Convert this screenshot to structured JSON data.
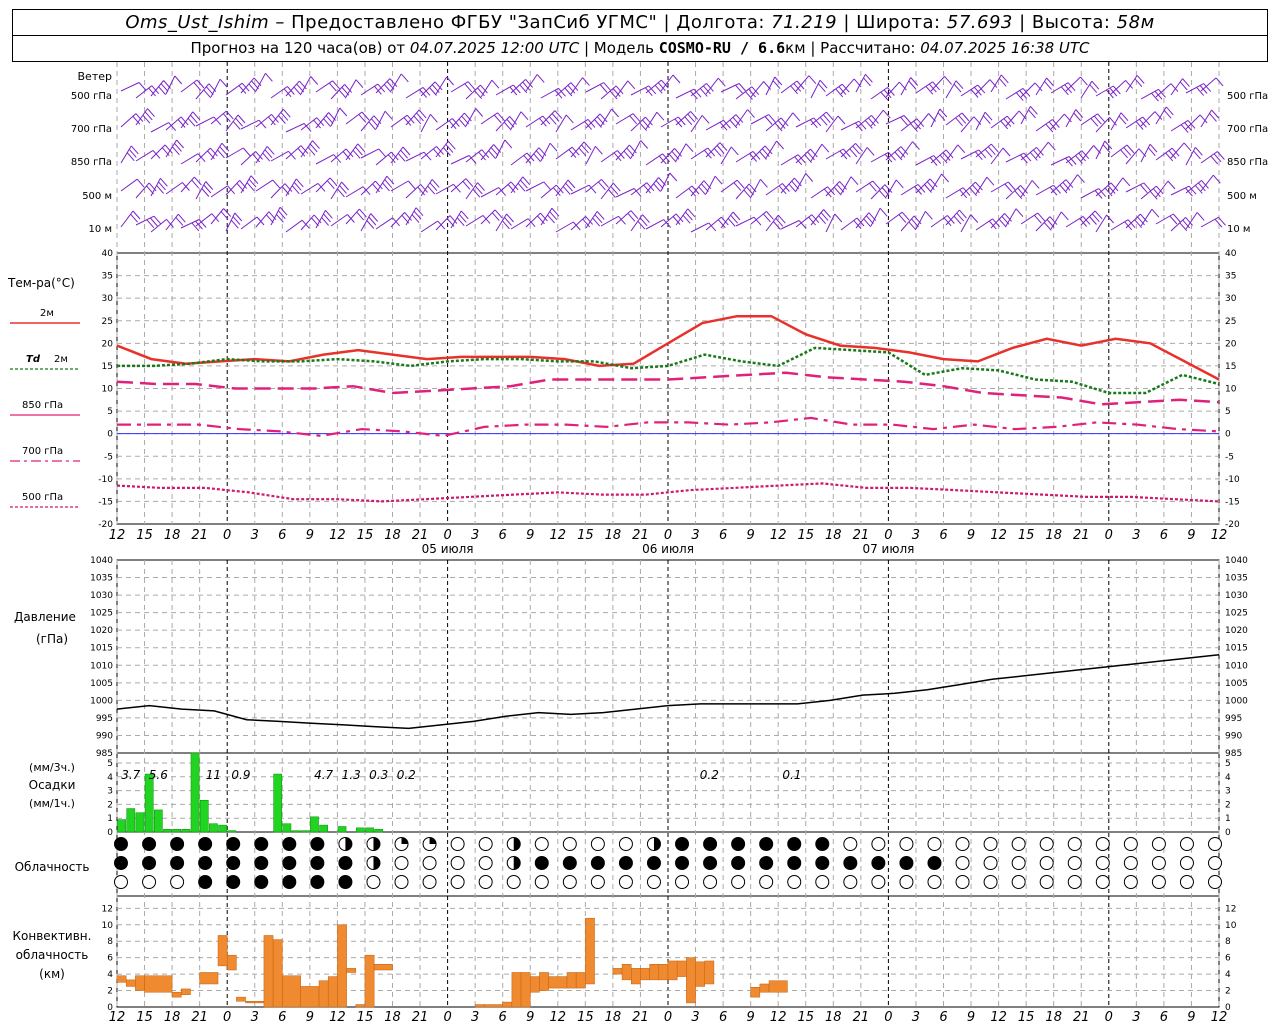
{
  "header": {
    "station": "Oms_Ust_Ishim",
    "provider": "– Предоставлено ФГБУ \"ЗапСиб УГМС\" |",
    "lon_label": "Долгота:",
    "lon": "71.219",
    "lat_label": "| Широта:",
    "lat": "57.693",
    "alt_label": "| Высота:",
    "alt": "58м",
    "forecast_label": "Прогноз на 120 часа(ов) от",
    "forecast_time": "04.07.2025 12:00 UTC",
    "model_label": "| Модель",
    "model": "COSMO-RU / 6.6",
    "model_unit": "км",
    "computed_label": "| Рассчитано:",
    "computed_time": "04.07.2025 16:38 UTC"
  },
  "labels": {
    "wind": "Ветер",
    "wind_levels": [
      "500 гПа",
      "700 гПа",
      "850 гПа",
      "500 м",
      "10  м"
    ],
    "temp_title": "Тем-ра(°C)",
    "legend_2m": "2м",
    "legend_td": "Td",
    "legend_td2": "2м",
    "legend_850": "850 гПа",
    "legend_700": "700 гПа",
    "legend_500": "500 гПа",
    "pressure_title": "Давление",
    "pressure_unit": "(гПа)",
    "precip_unit1": "(мм/3ч.)",
    "precip_title": "Осадки",
    "precip_unit2": "(мм/1ч.)",
    "cloud_title": "Облачность",
    "conv_title1": "Конвективн.",
    "conv_title2": "облачность",
    "conv_title3": "(км)",
    "days": [
      "05 июля",
      "06 июля",
      "07 июля"
    ]
  },
  "colors": {
    "t2m": "#e8312a",
    "td2m": "#1a7a1a",
    "t850": "#e0207a",
    "t700": "#e0207a",
    "t500": "#d01870",
    "wind": "#7a22c8",
    "precip": "#22d422",
    "conv": "#f08a30",
    "zero_line": "#3030ff"
  },
  "chart_data": [
    {
      "type": "line",
      "name": "temperature",
      "x_hours": [
        0,
        3,
        6,
        9,
        12,
        15,
        18,
        21,
        24,
        27,
        30,
        33,
        36,
        39,
        42,
        45,
        48,
        51,
        54,
        57,
        60,
        63,
        66,
        69,
        72,
        75,
        78,
        81,
        84,
        87,
        90,
        93,
        96,
        99,
        102,
        105,
        108,
        111,
        114,
        117,
        120
      ],
      "xticks": [
        "12",
        "15",
        "18",
        "21",
        "0",
        "3",
        "6",
        "9",
        "12",
        "15",
        "18",
        "21",
        "0",
        "3",
        "6",
        "9",
        "12",
        "15",
        "18",
        "21",
        "0",
        "3",
        "6",
        "9",
        "12",
        "15",
        "18",
        "21",
        "0",
        "3",
        "6",
        "9",
        "12",
        "15",
        "18",
        "21",
        "0",
        "3",
        "6",
        "9",
        "12",
        "15",
        "18"
      ],
      "ylim": [
        -20,
        40
      ],
      "yticks": [
        40,
        35,
        30,
        25,
        20,
        15,
        10,
        5,
        0,
        -5,
        -10,
        -15,
        -20
      ],
      "series": [
        {
          "key": "t2m",
          "values": [
            19.5,
            16.5,
            15.5,
            16.0,
            16.5,
            16.0,
            17.5,
            18.5,
            17.5,
            16.5,
            17.0,
            17.0,
            17.0,
            16.5,
            15.0,
            15.5,
            20.0,
            24.5,
            26.0,
            26.0,
            22.0,
            19.5,
            19.0,
            18.0,
            16.5,
            16.0,
            19.0,
            21.0,
            19.5,
            21.0,
            20.0,
            16.0,
            12.0
          ]
        },
        {
          "key": "td2m",
          "values": [
            15.0,
            15.0,
            15.5,
            16.5,
            16.0,
            16.0,
            16.5,
            16.0,
            15.0,
            16.0,
            16.5,
            16.5,
            16.0,
            16.0,
            14.5,
            15.0,
            17.5,
            16.0,
            15.0,
            19.0,
            18.5,
            18.0,
            13.0,
            14.5,
            14.0,
            12.0,
            11.5,
            9.0,
            9.0,
            13.0,
            11.0
          ]
        },
        {
          "key": "t850",
          "values": [
            11.5,
            11.0,
            11.0,
            10.0,
            10.0,
            10.0,
            10.5,
            9.0,
            9.5,
            10.0,
            10.5,
            12.0,
            12.0,
            12.0,
            12.0,
            12.5,
            13.0,
            13.5,
            12.5,
            12.0,
            11.5,
            10.5,
            9.0,
            8.5,
            8.0,
            6.5,
            7.0,
            7.5,
            7.0
          ]
        },
        {
          "key": "t700",
          "values": [
            2.0,
            2.0,
            2.0,
            1.0,
            0.5,
            -0.5,
            1.0,
            0.5,
            -0.5,
            1.5,
            2.0,
            2.0,
            1.5,
            2.5,
            2.5,
            2.0,
            2.5,
            3.5,
            2.0,
            2.0,
            1.0,
            2.0,
            1.0,
            1.5,
            2.5,
            2.0,
            1.0,
            0.5
          ]
        },
        {
          "key": "t500",
          "values": [
            -11.5,
            -12.0,
            -12.0,
            -13.0,
            -14.5,
            -14.5,
            -15.0,
            -14.5,
            -14.0,
            -13.5,
            -13.0,
            -13.5,
            -13.5,
            -12.5,
            -12.0,
            -11.5,
            -11.0,
            -12.0,
            -12.0,
            -12.5,
            -13.0,
            -13.5,
            -14.0,
            -14.0,
            -14.5,
            -15.0
          ]
        }
      ]
    },
    {
      "type": "line",
      "name": "pressure",
      "ylim": [
        985,
        1040
      ],
      "yticks": [
        1040,
        1035,
        1030,
        1025,
        1020,
        1015,
        1010,
        1005,
        1000,
        995,
        990,
        985
      ],
      "values": [
        997.5,
        998.5,
        997.5,
        997.0,
        994.5,
        994.0,
        993.5,
        993.0,
        992.5,
        992.0,
        993.0,
        994.0,
        995.5,
        996.5,
        996.0,
        996.5,
        997.5,
        998.5,
        999.0,
        999.0,
        999.0,
        999.0,
        1000.0,
        1001.5,
        1002.0,
        1003.0,
        1004.5,
        1006.0,
        1007.0,
        1008.0,
        1009.0,
        1010.0,
        1011.0,
        1012.0,
        1013.0
      ]
    },
    {
      "type": "bar",
      "name": "precipitation",
      "ylim": [
        0,
        5
      ],
      "yticks": [
        5,
        4,
        3,
        2,
        1,
        0
      ],
      "hourly": [
        0.9,
        1.7,
        1.4,
        4.2,
        1.6,
        0.2,
        0.2,
        0.2,
        5.8,
        2.3,
        0.6,
        0.5,
        0.1,
        0,
        0,
        0,
        0,
        4.2,
        0.6,
        0.1,
        0.1,
        1.1,
        0.5,
        0,
        0.4,
        0,
        0.3,
        0.3,
        0.2
      ],
      "totals_3h": [
        {
          "hour": 1.5,
          "value": "3.7"
        },
        {
          "hour": 4.5,
          "value": "5.6"
        },
        {
          "hour": 10.5,
          "value": "11"
        },
        {
          "hour": 13.5,
          "value": "0.9"
        },
        {
          "hour": 22.5,
          "value": "4.7"
        },
        {
          "hour": 25.5,
          "value": "1.3"
        },
        {
          "hour": 28.5,
          "value": "0.3"
        },
        {
          "hour": 31.5,
          "value": "0.2"
        },
        {
          "hour": 64.5,
          "value": "0.2"
        },
        {
          "hour": 73.5,
          "value": "0.1"
        }
      ]
    },
    {
      "type": "bar",
      "name": "convective_cloud",
      "ylim": [
        0,
        13
      ],
      "yticks": [
        12,
        10,
        8,
        6,
        4,
        2,
        0
      ],
      "segments": [
        {
          "h0": 0,
          "h1": 1,
          "b": 3,
          "t": 3.8
        },
        {
          "h0": 1,
          "h1": 2,
          "b": 2.5,
          "t": 3.3
        },
        {
          "h0": 2,
          "h1": 3,
          "b": 2,
          "t": 3.8
        },
        {
          "h0": 3,
          "h1": 6,
          "b": 1.8,
          "t": 3.8
        },
        {
          "h0": 6,
          "h1": 7,
          "b": 1.2,
          "t": 1.8
        },
        {
          "h0": 7,
          "h1": 8,
          "b": 1.5,
          "t": 2.2
        },
        {
          "h0": 9,
          "h1": 11,
          "b": 2.8,
          "t": 4.2
        },
        {
          "h0": 11,
          "h1": 12,
          "b": 5,
          "t": 8.7
        },
        {
          "h0": 12,
          "h1": 13,
          "b": 4.5,
          "t": 6.3
        },
        {
          "h0": 13,
          "h1": 14,
          "b": 0.7,
          "t": 1.2
        },
        {
          "h0": 14,
          "h1": 16,
          "b": 0.5,
          "t": 0.7
        },
        {
          "h0": 16,
          "h1": 17,
          "b": 0,
          "t": 8.7
        },
        {
          "h0": 17,
          "h1": 18,
          "b": 0,
          "t": 8.2
        },
        {
          "h0": 18,
          "h1": 20,
          "b": 0,
          "t": 3.8
        },
        {
          "h0": 20,
          "h1": 22,
          "b": 0,
          "t": 2.5
        },
        {
          "h0": 22,
          "h1": 23,
          "b": 0,
          "t": 3.2
        },
        {
          "h0": 23,
          "h1": 24,
          "b": 0,
          "t": 3.7
        },
        {
          "h0": 24,
          "h1": 25,
          "b": 0,
          "t": 10
        },
        {
          "h0": 25,
          "h1": 26,
          "b": 4.2,
          "t": 4.7
        },
        {
          "h0": 26,
          "h1": 27,
          "b": 0,
          "t": 0.3
        },
        {
          "h0": 27,
          "h1": 28,
          "b": 0,
          "t": 6.3
        },
        {
          "h0": 28,
          "h1": 30,
          "b": 4.5,
          "t": 5.2
        },
        {
          "h0": 39,
          "h1": 40,
          "b": 0,
          "t": 0.3
        },
        {
          "h0": 40,
          "h1": 42,
          "b": 0,
          "t": 0.3
        },
        {
          "h0": 42,
          "h1": 43,
          "b": 0,
          "t": 0.6
        },
        {
          "h0": 43,
          "h1": 44,
          "b": 0,
          "t": 4.2
        },
        {
          "h0": 44,
          "h1": 45,
          "b": 0,
          "t": 4.2
        },
        {
          "h0": 45,
          "h1": 46,
          "b": 1.8,
          "t": 3.7
        },
        {
          "h0": 46,
          "h1": 47,
          "b": 2.0,
          "t": 4.2
        },
        {
          "h0": 47,
          "h1": 49,
          "b": 2.3,
          "t": 3.7
        },
        {
          "h0": 49,
          "h1": 50,
          "b": 2.3,
          "t": 4.2
        },
        {
          "h0": 50,
          "h1": 51,
          "b": 2.3,
          "t": 4.2
        },
        {
          "h0": 51,
          "h1": 52,
          "b": 2.8,
          "t": 10.8
        },
        {
          "h0": 54,
          "h1": 55,
          "b": 4,
          "t": 4.7
        },
        {
          "h0": 55,
          "h1": 56,
          "b": 3.3,
          "t": 5.2
        },
        {
          "h0": 56,
          "h1": 57,
          "b": 2.8,
          "t": 4.7
        },
        {
          "h0": 57,
          "h1": 58,
          "b": 3.3,
          "t": 4.7
        },
        {
          "h0": 58,
          "h1": 59,
          "b": 3.3,
          "t": 5.2
        },
        {
          "h0": 59,
          "h1": 60,
          "b": 3.3,
          "t": 5.2
        },
        {
          "h0": 60,
          "h1": 61,
          "b": 3.3,
          "t": 5.6
        },
        {
          "h0": 61,
          "h1": 62,
          "b": 3.7,
          "t": 5.6
        },
        {
          "h0": 62,
          "h1": 63,
          "b": 0.5,
          "t": 6
        },
        {
          "h0": 63,
          "h1": 64,
          "b": 2.5,
          "t": 5.5
        },
        {
          "h0": 64,
          "h1": 65,
          "b": 2.8,
          "t": 5.6
        },
        {
          "h0": 69,
          "h1": 70,
          "b": 1.2,
          "t": 2.4
        },
        {
          "h0": 70,
          "h1": 71,
          "b": 1.8,
          "t": 2.8
        },
        {
          "h0": 71,
          "h1": 73,
          "b": 1.8,
          "t": 3.2
        }
      ]
    },
    {
      "type": "table",
      "name": "cloud_cover",
      "columns": 40,
      "rows": [
        "ddddddddhhffqqhqqqqhddddddqqqqqqqqqqqqqqqqqqhhhqhfqqqhhhhqqqqqqqqqqqqqqqqqqqqqqqq",
        "dddddddddhqqqqhdddddddddddddddqqqqqqqqqqqqqqqqqqqfhdddddddddqqqqqqqqqqqqqqqqqqqqqq",
        "qqqddddddqqqqqqqqqqqqqqqqqqqqqqqqqqqqqqqqqqqqqqqqqqqqqqqqqqqqqqqqqqqqqqqqqqqqqqqqq"
      ]
    }
  ]
}
